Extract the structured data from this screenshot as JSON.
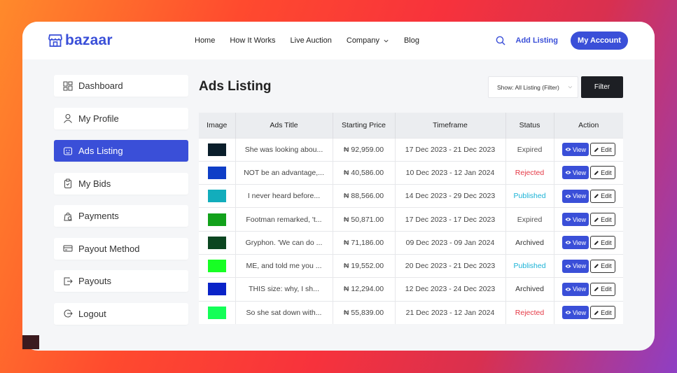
{
  "brand": {
    "name": "bazaar",
    "color": "#3a4fd8"
  },
  "nav": {
    "links": [
      "Home",
      "How It Works",
      "Live Auction",
      "Company",
      "Blog"
    ],
    "add_listing": "Add Listing",
    "account": "My Account"
  },
  "sidebar": {
    "items": [
      {
        "label": "Dashboard",
        "icon": "dashboard-icon",
        "active": false
      },
      {
        "label": "My Profile",
        "icon": "user-icon",
        "active": false
      },
      {
        "label": "Ads Listing",
        "icon": "ads-icon",
        "active": true
      },
      {
        "label": "My Bids",
        "icon": "bids-icon",
        "active": false
      },
      {
        "label": "Payments",
        "icon": "payments-icon",
        "active": false
      },
      {
        "label": "Payout Method",
        "icon": "card-icon",
        "active": false
      },
      {
        "label": "Payouts",
        "icon": "payouts-icon",
        "active": false
      },
      {
        "label": "Logout",
        "icon": "logout-icon",
        "active": false
      }
    ]
  },
  "main": {
    "title": "Ads Listing",
    "filter_select": "Show: All Listing (Filter)",
    "filter_button": "Filter"
  },
  "table": {
    "columns": [
      "Image",
      "Ads Title",
      "Starting Price",
      "Timeframe",
      "Status",
      "Action"
    ],
    "view_label": "View",
    "edit_label": "Edit",
    "rows": [
      {
        "color": "#0a1e2b",
        "title": "She was looking abou...",
        "price": "₦ 92,959.00",
        "timeframe": "17 Dec 2023 - 21 Dec 2023",
        "status": "Expired"
      },
      {
        "color": "#0f3ec7",
        "title": "NOT be an advantage,...",
        "price": "₦ 40,586.00",
        "timeframe": "10 Dec 2023 - 12 Jan 2024",
        "status": "Rejected"
      },
      {
        "color": "#12adbc",
        "title": "I never heard before...",
        "price": "₦ 88,566.00",
        "timeframe": "14 Dec 2023 - 29 Dec 2023",
        "status": "Published"
      },
      {
        "color": "#12a11b",
        "title": "Footman remarked, 't...",
        "price": "₦ 50,871.00",
        "timeframe": "17 Dec 2023 - 17 Dec 2023",
        "status": "Expired"
      },
      {
        "color": "#0b4620",
        "title": "Gryphon. 'We can do ...",
        "price": "₦ 71,186.00",
        "timeframe": "09 Dec 2023 - 09 Jan 2024",
        "status": "Archived"
      },
      {
        "color": "#17ff24",
        "title": "ME, and told me you ...",
        "price": "₦ 19,552.00",
        "timeframe": "20 Dec 2023 - 21 Dec 2023",
        "status": "Published"
      },
      {
        "color": "#0a23c8",
        "title": "THIS size: why, I sh...",
        "price": "₦ 12,294.00",
        "timeframe": "12 Dec 2023 - 24 Dec 2023",
        "status": "Archived"
      },
      {
        "color": "#13ff57",
        "title": "So she sat down with...",
        "price": "₦ 55,839.00",
        "timeframe": "21 Dec 2023 - 12 Jan 2024",
        "status": "Rejected"
      }
    ]
  }
}
